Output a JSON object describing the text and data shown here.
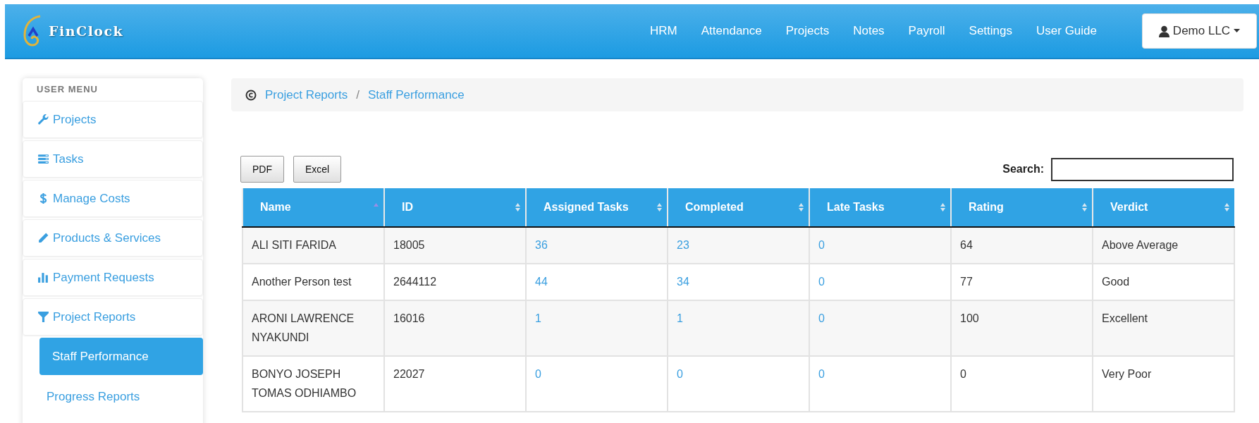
{
  "header": {
    "logo_text": "FinClock",
    "nav": [
      "HRM",
      "Attendance",
      "Projects",
      "Notes",
      "Payroll",
      "Settings",
      "User Guide"
    ],
    "account": "Demo LLC"
  },
  "sidebar": {
    "title": "USER MENU",
    "items": [
      {
        "label": "Projects"
      },
      {
        "label": "Tasks"
      },
      {
        "label": "Manage Costs"
      },
      {
        "label": "Products & Services"
      },
      {
        "label": "Payment Requests"
      },
      {
        "label": "Project Reports",
        "children": [
          {
            "label": "Staff Performance",
            "selected": true
          },
          {
            "label": "Progress Reports",
            "selected": false
          }
        ]
      }
    ]
  },
  "breadcrumb": {
    "items": [
      "Project Reports",
      "Staff Performance"
    ],
    "separator": "/"
  },
  "toolbar": {
    "buttons": [
      "PDF",
      "Excel"
    ],
    "search_label": "Search:"
  },
  "table": {
    "columns": [
      {
        "label": "Name",
        "sorted": true,
        "link": false
      },
      {
        "label": "ID",
        "sorted": false,
        "link": false
      },
      {
        "label": "Assigned Tasks",
        "sorted": false,
        "link": true
      },
      {
        "label": "Completed",
        "sorted": false,
        "link": true
      },
      {
        "label": "Late Tasks",
        "sorted": false,
        "link": true
      },
      {
        "label": "Rating",
        "sorted": false,
        "link": false
      },
      {
        "label": "Verdict",
        "sorted": false,
        "link": false
      }
    ],
    "rows": [
      [
        "ALI SITI FARIDA",
        "18005",
        "36",
        "23",
        "0",
        "64",
        "Above Average"
      ],
      [
        "Another Person test",
        "2644112",
        "44",
        "34",
        "0",
        "77",
        "Good"
      ],
      [
        "ARONI LAWRENCE NYAKUNDI",
        "16016",
        "1",
        "1",
        "0",
        "100",
        "Excellent"
      ],
      [
        "BONYO JOSEPH TOMAS ODHIAMBO",
        "22027",
        "0",
        "0",
        "0",
        "0",
        "Very Poor"
      ]
    ]
  }
}
